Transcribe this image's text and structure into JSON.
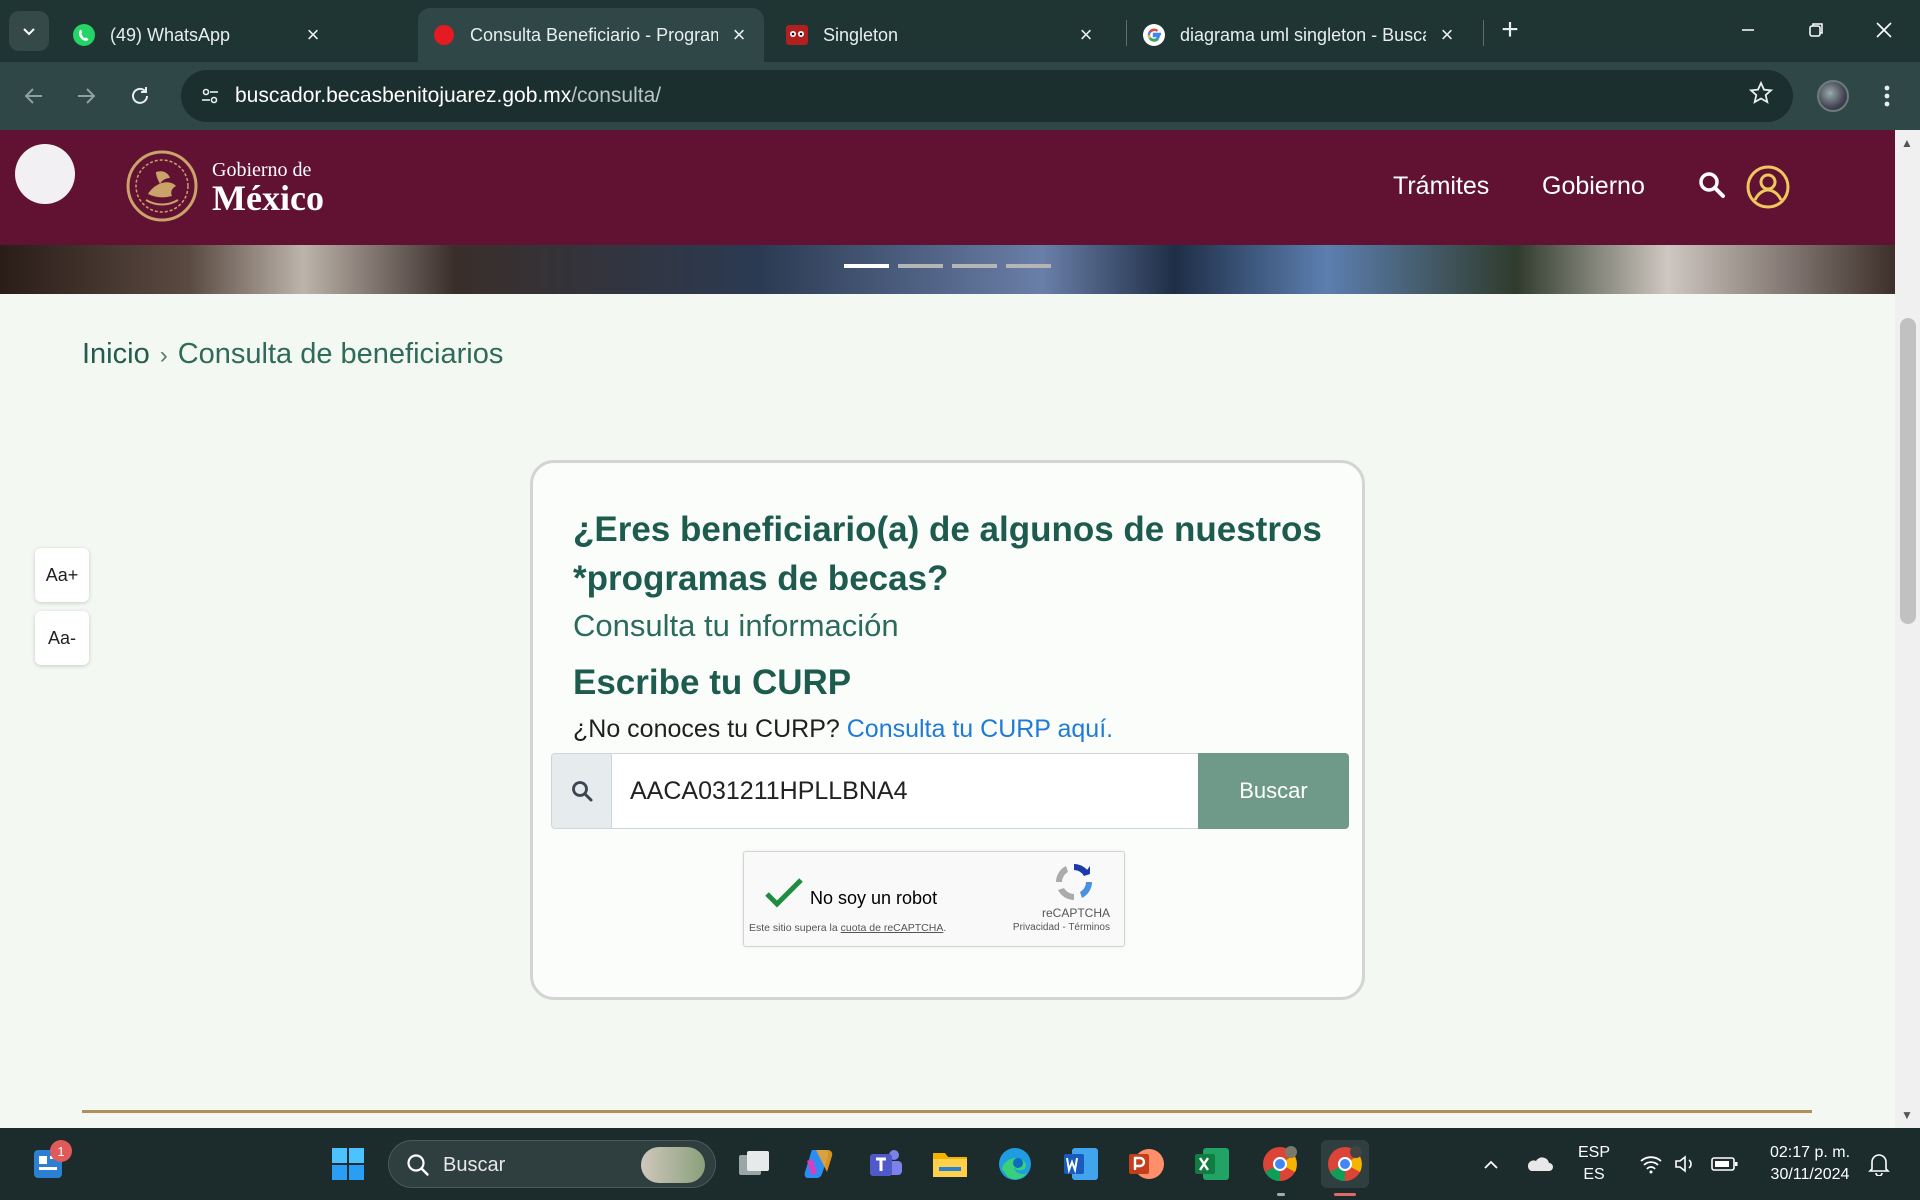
{
  "browser": {
    "tabs": [
      {
        "title": "(49) WhatsApp",
        "icon": "whatsapp-icon",
        "active": false
      },
      {
        "title": "Consulta Beneficiario - Program",
        "icon": "red-dot-icon",
        "active": true
      },
      {
        "title": "Singleton",
        "icon": "raccoon-icon",
        "active": false
      },
      {
        "title": "diagrama uml singleton - Busca",
        "icon": "google-icon",
        "active": false
      }
    ],
    "url_host": "buscador.becasbenitojuarez.gob.mx",
    "url_path": "/consulta/"
  },
  "gov_header": {
    "logo_line1": "Gobierno de",
    "logo_line2": "México",
    "nav": [
      "Trámites",
      "Gobierno"
    ],
    "brand_color": "#611232"
  },
  "breadcrumb": {
    "home": "Inicio",
    "separator": "›",
    "current": "Consulta de beneficiarios"
  },
  "font_controls": {
    "increase": "Aa+",
    "decrease": "Aa-"
  },
  "form": {
    "question": "¿Eres beneficiario(a) de algunos de nuestros *programas de becas?",
    "subtitle": "Consulta tu información",
    "curp_title": "Escribe tu CURP",
    "hint_text": "¿No conoces tu CURP?",
    "hint_link": "Consulta tu CURP aquí.",
    "curp_value": "AACA031211HPLLBNA4",
    "search_button": "Buscar"
  },
  "recaptcha": {
    "label": "No soy un robot",
    "brand": "reCAPTCHA",
    "links": "Privacidad - Términos",
    "note_prefix": "Este sitio supera la ",
    "note_link": "cuota de reCAPTCHA",
    "note_suffix": "."
  },
  "taskbar": {
    "search_label": "Buscar",
    "notification_count": "1",
    "lang_top": "ESP",
    "lang_bottom": "ES",
    "time": "02:17 p. m.",
    "date": "30/11/2024"
  },
  "colors": {
    "accent_green": "#1e5b4f",
    "button_green": "#6f9a89",
    "link_blue": "#1f7bd4",
    "gold_line": "#b38e5d"
  }
}
